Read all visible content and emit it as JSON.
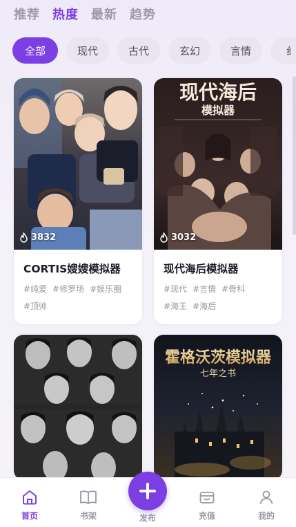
{
  "top_tabs": [
    {
      "label": "推荐",
      "active": false
    },
    {
      "label": "热度",
      "active": true
    },
    {
      "label": "最新",
      "active": false
    },
    {
      "label": "趋势",
      "active": false
    }
  ],
  "categories": [
    {
      "label": "全部",
      "active": true
    },
    {
      "label": "现代",
      "active": false
    },
    {
      "label": "古代",
      "active": false
    },
    {
      "label": "玄幻",
      "active": false
    },
    {
      "label": "言情",
      "active": false
    },
    {
      "label": "纟",
      "active": false
    }
  ],
  "cards": [
    {
      "title": "CORTIS嫂嫂模拟器",
      "heat": "3832",
      "tags": [
        "#纯爱",
        "#修罗场",
        "#娱乐圈",
        "#顶帅"
      ],
      "cover_theme": "group-photo-color"
    },
    {
      "title": "现代海后模拟器",
      "heat": "3032",
      "cover_title": "现代海后",
      "cover_subtitle": "模拟器",
      "tags": [
        "#现代",
        "#言情",
        "#骨科",
        "#海王",
        "#海后"
      ],
      "cover_theme": "dark-poster"
    },
    {
      "title": "",
      "heat": "",
      "tags": [],
      "cover_theme": "group-photo-bw"
    },
    {
      "title": "",
      "heat": "",
      "cover_title": "霍格沃茨模拟器",
      "cover_subtitle": "七年之书",
      "tags": [],
      "cover_theme": "castle-night"
    }
  ],
  "bottom_nav": {
    "home": "首页",
    "shelf": "书架",
    "publish": "发布",
    "recharge": "充值",
    "mine": "我的"
  },
  "colors": {
    "accent": "#7b3fe4",
    "inactive": "#9b98a6",
    "background": "#f3f0f8"
  }
}
